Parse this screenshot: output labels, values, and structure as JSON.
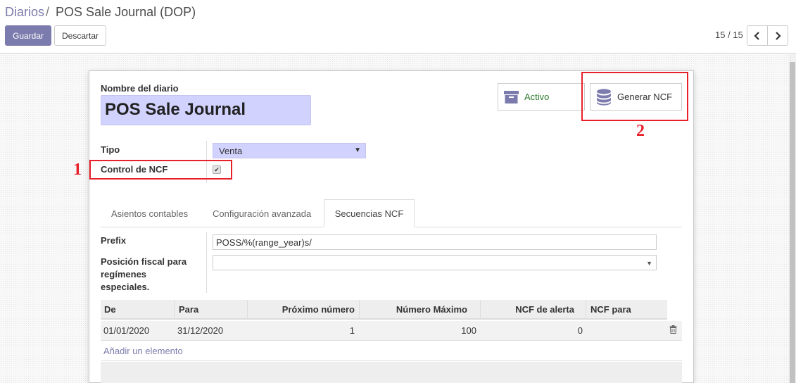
{
  "breadcrumb": {
    "parent": "Diarios",
    "separator": "/",
    "current": "POS Sale Journal (DOP)"
  },
  "toolbar": {
    "save_label": "Guardar",
    "discard_label": "Descartar"
  },
  "pager": {
    "value": "15 / 15",
    "prev_icon": "chevron-left-icon",
    "next_icon": "chevron-right-icon"
  },
  "form": {
    "name_label": "Nombre del diario",
    "name_value": "POS Sale Journal",
    "type_label": "Tipo",
    "type_value": "Venta",
    "ncf_control_label": "Control de NCF",
    "ncf_control_checked": true
  },
  "smart_buttons": {
    "active_label": "Activo",
    "generate_label": "Generar NCF"
  },
  "annotations": {
    "mark1": "1",
    "mark2": "2"
  },
  "tabs": [
    {
      "label": "Asientos contables",
      "active": false
    },
    {
      "label": "Configuración avanzada",
      "active": false
    },
    {
      "label": "Secuencias NCF",
      "active": true
    }
  ],
  "ncf_tab": {
    "prefix_label": "Prefix",
    "prefix_value": "POSS/%(range_year)s/",
    "fiscal_label_line1": "Posición fiscal para",
    "fiscal_label_line2": "regímenes",
    "fiscal_label_line3": "especiales.",
    "fiscal_value": ""
  },
  "table": {
    "columns": [
      "De",
      "Para",
      "Próximo número",
      "Número Máximo",
      "NCF de alerta",
      "NCF para"
    ],
    "rows": [
      {
        "de": "01/01/2020",
        "para": "31/12/2020",
        "proximo": "1",
        "maximo": "100",
        "alerta": "0",
        "ncf_para": ""
      }
    ],
    "add_label": "Añadir un elemento"
  },
  "colors": {
    "primary": "#7c7bad",
    "annotation_red": "#e8202a",
    "field_highlight": "#d2d2ff",
    "active_green": "#2c7a2c"
  }
}
